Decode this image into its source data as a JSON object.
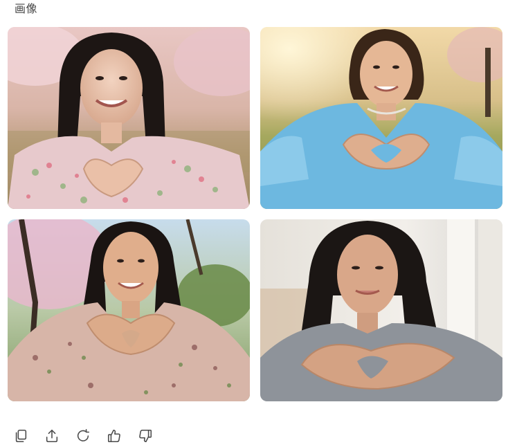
{
  "section": {
    "title": "画像"
  },
  "images": [
    {
      "name": "image-1",
      "icon": "photo-woman-floral-dress-heart-hands"
    },
    {
      "name": "image-2",
      "icon": "photo-woman-blue-dress-heart-hands"
    },
    {
      "name": "image-3",
      "icon": "photo-woman-floral-wrap-heart-hands"
    },
    {
      "name": "image-4",
      "icon": "photo-woman-gray-shirt-heart-hands"
    }
  ],
  "actions": [
    {
      "icon": "copy-icon"
    },
    {
      "icon": "share-icon"
    },
    {
      "icon": "regenerate-icon"
    },
    {
      "icon": "thumbs-up-icon"
    },
    {
      "icon": "thumbs-down-icon"
    }
  ],
  "colors": {
    "background": "#ffffff",
    "icon_stroke": "#4a4a4a",
    "title_text": "#444444"
  }
}
